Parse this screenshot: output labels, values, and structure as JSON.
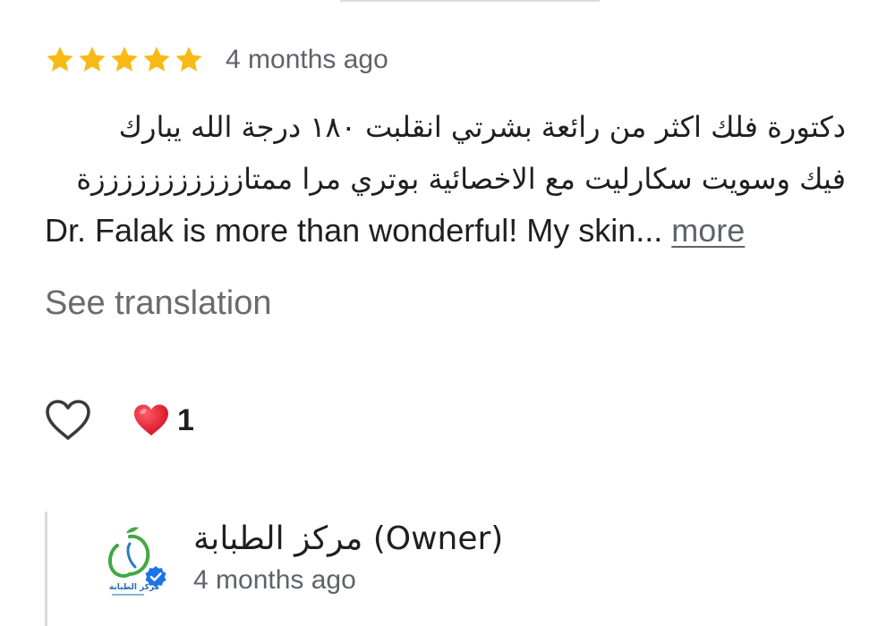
{
  "review": {
    "rating": 5,
    "rating_max": 5,
    "star_color": "#f9b916",
    "date": "4 months ago",
    "text_lines": [
      "دكتورة فلك اكثر من رائعة بشرتي انقلبت ١٨٠ درجة الله يبارك",
      "فيك وسويت سكارليت مع الاخصائية بوتري مرا ممتازززززززززززة"
    ],
    "translated_snippet": "Dr. Falak is more than wonderful! My skin...",
    "more_label": "more",
    "see_translation_label": "See translation"
  },
  "reactions": {
    "like_icon": "heart-outline-icon",
    "reaction_icon": "red-heart-icon",
    "reaction_color": "#e0182b",
    "count": "1"
  },
  "owner_reply": {
    "name": "مركز الطبابة (Owner)",
    "date": "4 months ago",
    "avatar_icon": "clinic-logo-icon",
    "logo_caption": "مركز الطبابة",
    "badge_icon": "verified-check-icon",
    "badge_color": "#1a73e8"
  }
}
